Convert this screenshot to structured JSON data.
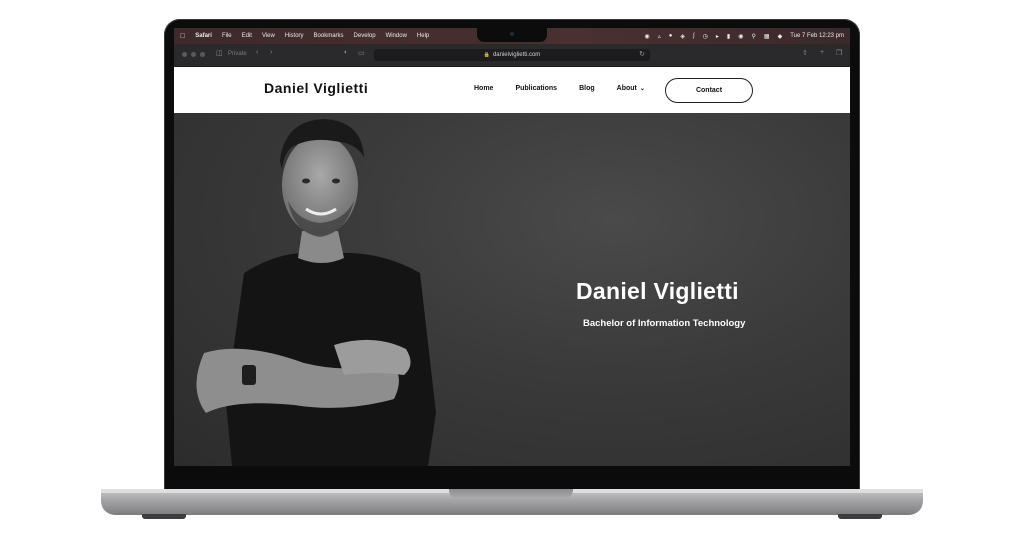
{
  "menubar": {
    "app": "Safari",
    "items": [
      "File",
      "Edit",
      "View",
      "History",
      "Bookmarks",
      "Develop",
      "Window",
      "Help"
    ],
    "datetime": "Tue 7 Feb  12:23 pm"
  },
  "browser": {
    "tab_label": "Private",
    "url": "danielviglietti.com"
  },
  "site": {
    "brand": "Daniel Viglietti",
    "nav": {
      "home": "Home",
      "publications": "Publications",
      "blog": "Blog",
      "about": "About",
      "contact": "Contact"
    },
    "hero": {
      "title": "Daniel Viglietti",
      "subtitle": "Bachelor of Information Technology"
    }
  },
  "icons": {
    "apple": "apple-logo-icon",
    "lock": "lock-icon",
    "reload": "reload-icon"
  }
}
